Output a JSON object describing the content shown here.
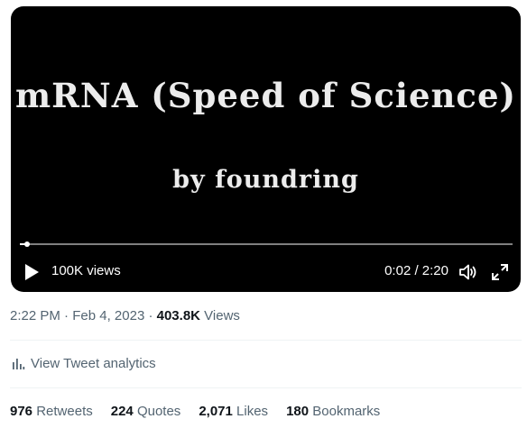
{
  "video": {
    "title_text": "mRNA (Speed of Science)",
    "subtitle_text": "by foundring",
    "views_overlay": "100K views",
    "time": "0:02 / 2:20",
    "progress": 0.014
  },
  "tweet_meta": {
    "time": "2:22 PM",
    "sep1": "·",
    "date": "Feb 4, 2023",
    "sep2": "·",
    "views_count": "403.8K",
    "views_label": "Views"
  },
  "analytics": {
    "label": "View Tweet analytics"
  },
  "stats": {
    "retweets_count": "976",
    "retweets_label": "Retweets",
    "quotes_count": "224",
    "quotes_label": "Quotes",
    "likes_count": "2,071",
    "likes_label": "Likes",
    "bookmarks_count": "180",
    "bookmarks_label": "Bookmarks"
  },
  "icons": {
    "play": "play-icon",
    "volume": "volume-icon",
    "fullscreen": "fullscreen-icon",
    "analytics": "bar-chart-icon"
  },
  "colors": {
    "video_bg": "#000000",
    "text_primary": "#0f1419",
    "text_secondary": "#536471",
    "divider": "#eff3f4"
  }
}
